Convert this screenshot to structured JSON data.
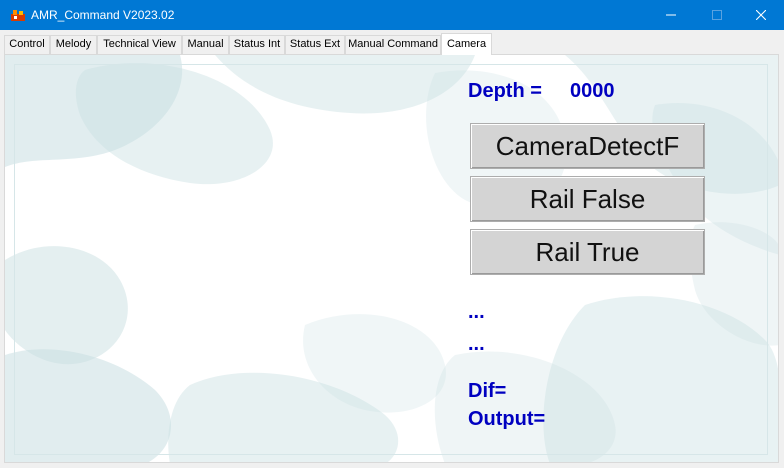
{
  "window": {
    "title": "AMR_Command V2023.02",
    "icons": [
      "app-icon",
      "minimize-icon",
      "maximize-icon",
      "close-icon"
    ]
  },
  "tabs": [
    {
      "label": "Control"
    },
    {
      "label": "Melody"
    },
    {
      "label": "Technical View"
    },
    {
      "label": "Manual"
    },
    {
      "label": "Status Int"
    },
    {
      "label": "Status Ext"
    },
    {
      "label": "Manual Command"
    },
    {
      "label": "Camera",
      "active": true
    }
  ],
  "camera": {
    "depth_label": "Depth =",
    "depth_value": "0000",
    "buttons": {
      "detect": "CameraDetectF",
      "rail_false": "Rail False",
      "rail_true": "Rail True"
    },
    "status1": "...",
    "status2": "...",
    "dif_label": "Dif=",
    "output_label": "Output="
  },
  "colors": {
    "titlebar": "#0078d4",
    "label_text": "#0000c0",
    "button_face": "#d4d4d4",
    "background_wash": "#c9dfe2"
  }
}
